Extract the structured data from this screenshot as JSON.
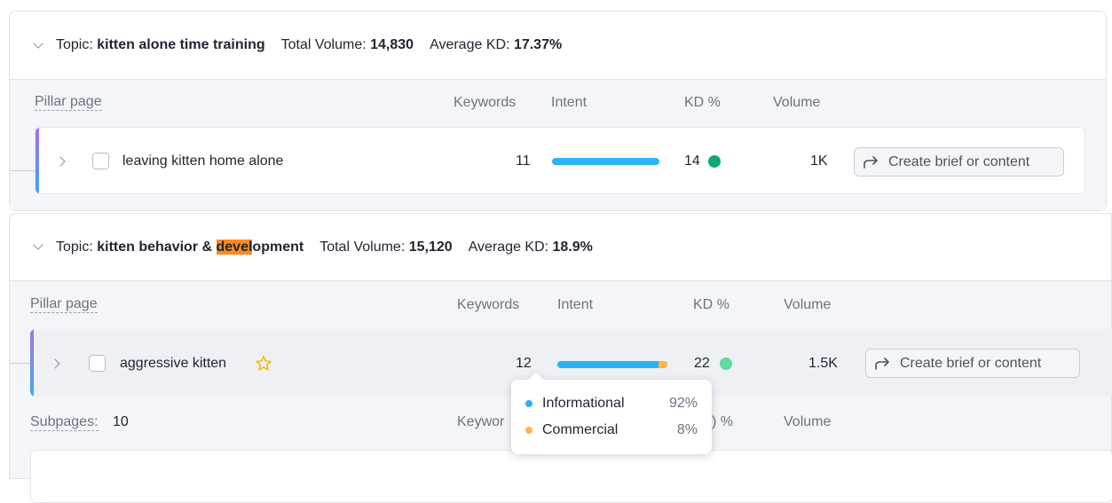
{
  "topic1": {
    "label": "Topic:",
    "name": "kitten alone time training",
    "volume_label": "Total Volume:",
    "volume": "14,830",
    "kd_label": "Average KD:",
    "kd": "17.37%",
    "columns": {
      "pillar": "Pillar page",
      "keywords": "Keywords",
      "intent": "Intent",
      "kd": "KD %",
      "volume": "Volume"
    },
    "pillar_row": {
      "title": "leaving kitten home alone",
      "keywords": "11",
      "kd": "14",
      "kd_color": "#0bab76",
      "intent": {
        "informational": 1.0,
        "commercial": 0.0
      },
      "volume": "1K",
      "button": "Create brief or content"
    }
  },
  "topic2": {
    "label": "Topic:",
    "name_pre": "kitten behavior & ",
    "name_hl": "devel",
    "name_post": "opment",
    "volume_label": "Total Volume:",
    "volume": "15,120",
    "kd_label": "Average KD:",
    "kd": "18.9%",
    "columns": {
      "pillar": "Pillar page",
      "keywords": "Keywords",
      "intent": "Intent",
      "kd": "KD %",
      "volume": "Volume"
    },
    "pillar_row": {
      "title": "aggressive kitten",
      "keywords": "12",
      "kd": "22",
      "kd_color": "#5fd9a0",
      "intent": {
        "informational": 0.92,
        "commercial": 0.08
      },
      "volume": "1.5K",
      "button": "Create brief or content"
    },
    "subpages": {
      "label": "Subpages:",
      "count": "10",
      "keywords_partial": "Keywor",
      "kd_partial": ") %",
      "volume": "Volume"
    }
  },
  "tooltip": {
    "items": [
      {
        "name": "Informational",
        "pct": "92%",
        "color": "#2cb1f4"
      },
      {
        "name": "Commercial",
        "pct": "8%",
        "color": "#ffb83f"
      }
    ]
  },
  "colors": {
    "accent_start": "#a66df0",
    "accent_end": "#3fa7ff",
    "highlight": "#ff8a1f"
  }
}
